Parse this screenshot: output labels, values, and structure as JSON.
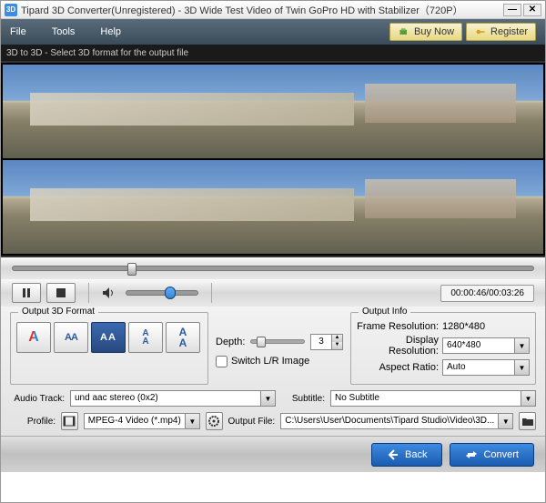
{
  "window": {
    "title": "Tipard 3D Converter(Unregistered) - 3D Wide Test Video of Twin GoPro HD with Stabilizer（720P）"
  },
  "menu": {
    "file": "File",
    "tools": "Tools",
    "help": "Help",
    "buy": "Buy Now",
    "register": "Register"
  },
  "subheader": "3D to 3D - Select 3D format for the output file",
  "playback": {
    "time": "00:00:46/00:03:26",
    "progress_pct": 22,
    "volume_pct": 55
  },
  "format": {
    "legend": "Output 3D Format",
    "option_anaglyph": "A",
    "option_sbs_half": "AA",
    "option_sbs_full": "AA",
    "option_tb_half": "A\nA",
    "option_tb_full": "A\nA",
    "selected_index": 2
  },
  "depth": {
    "label": "Depth:",
    "value": "3"
  },
  "switch": {
    "label": "Switch L/R Image",
    "checked": false
  },
  "info": {
    "legend": "Output Info",
    "frame_label": "Frame Resolution:",
    "frame_value": "1280*480",
    "display_label": "Display Resolution:",
    "display_value": "640*480",
    "aspect_label": "Aspect Ratio:",
    "aspect_value": "Auto"
  },
  "audio": {
    "label": "Audio Track:",
    "value": "und aac stereo (0x2)"
  },
  "subtitle": {
    "label": "Subtitle:",
    "value": "No Subtitle"
  },
  "profile": {
    "label": "Profile:",
    "value": "MPEG-4 Video (*.mp4)"
  },
  "output": {
    "label": "Output File:",
    "value": "C:\\Users\\User\\Documents\\Tipard Studio\\Video\\3D..."
  },
  "footer": {
    "back": "Back",
    "convert": "Convert"
  }
}
